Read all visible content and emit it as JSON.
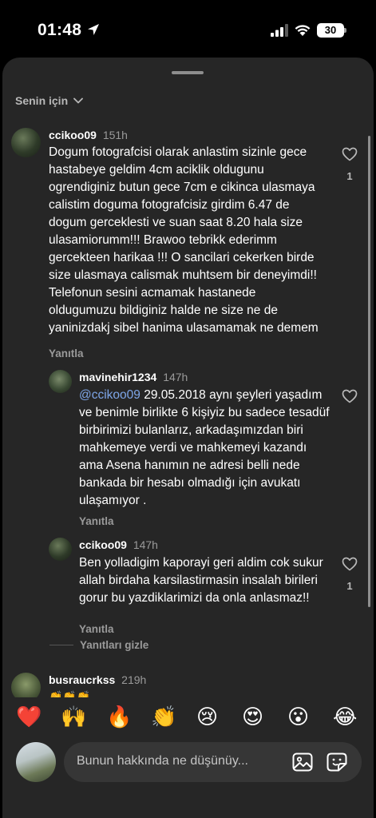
{
  "status": {
    "time": "01:48",
    "battery": "30"
  },
  "sort": {
    "label": "Senin için"
  },
  "comments": [
    {
      "username": "ccikoo09",
      "time": "151h",
      "text": "Dogum fotografcisi olarak anlastim sizinle gece hastabeye geldim 4cm aciklik oldugunu ogrendiginiz butun gece 7cm e cikinca ulasmaya calistim doguma fotografcisiz girdim 6.47 de dogum gerceklesti ve suan saat 8.20 hala size ulasamiorumm!!! Brawoo tebrikk ederimm gercekteen harikaa !!! O sancilari cekerken birde size ulasmaya calismak muhtsem bir deneyimdi!! Telefonun sesini acmamak hastanede oldugumuzu bildiginiz halde ne size ne de yaninizdakj sibel hanima ulasamamak ne demem",
      "reply": "Yanıtla",
      "likes": "1"
    },
    {
      "username": "mavinehir1234",
      "time": "147h",
      "mention": "@ccikoo09",
      "text": " 29.05.2018 aynı şeyleri yaşadım ve benimle birlikte 6 kişiyiz bu sadece tesadüf birbirimizi bulanlarız, arkadaşımızdan biri mahkemeye verdi ve mahkemeyi kazandı ama Asena hanımın ne adresi belli nede bankada bir hesabı olmadığı için avukatı ulaşamıyor .",
      "reply": "Yanıtla"
    },
    {
      "username": "ccikoo09",
      "time": "147h",
      "text": "Ben yolladigim kaporayi geri aldim cok sukur allah birdaha karsilastirmasin insalah birileri gorur bu yazdiklarimizi da onla anlasmaz!!",
      "reply": "Yanıtla",
      "likes": "1"
    },
    {
      "username": "busraucrkss",
      "time": "219h",
      "text": "👏👏👏"
    }
  ],
  "hide_replies": "Yanıtları gizle",
  "emojis": [
    "❤️",
    "🙌",
    "🔥",
    "👏",
    "😢",
    "😍",
    "😮",
    "😂"
  ],
  "composer": {
    "placeholder": "Bunun hakkında ne düşünüy..."
  }
}
